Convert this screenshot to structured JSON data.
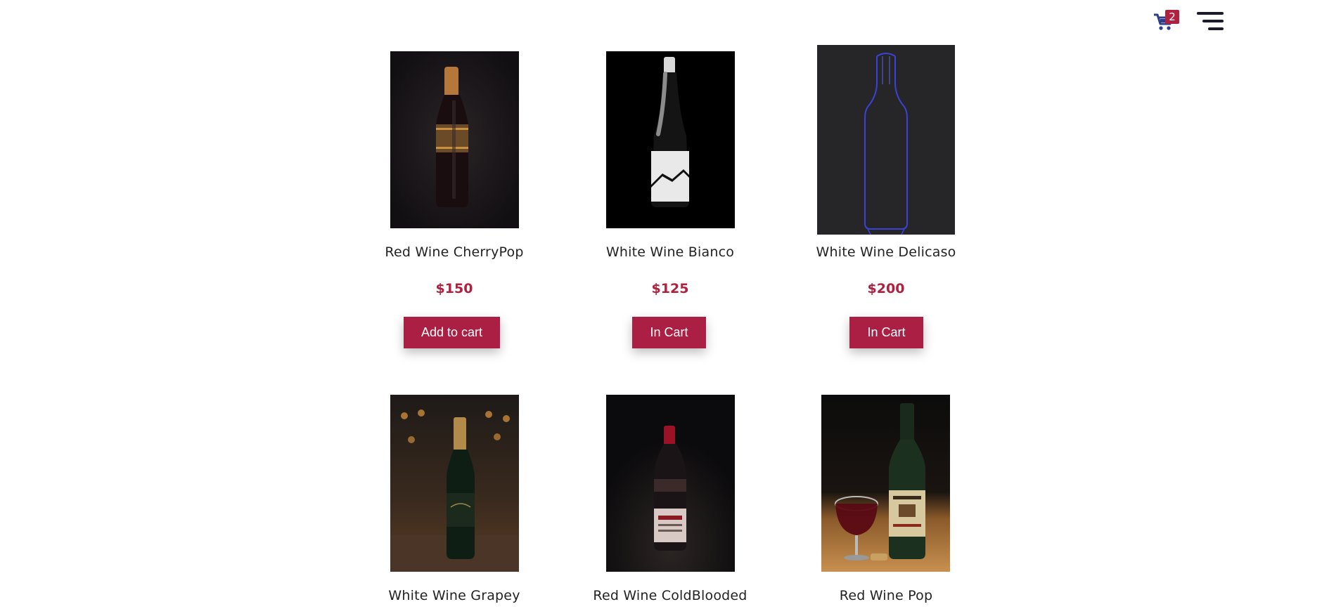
{
  "header": {
    "cart_count": "2",
    "accent_color": "#b0213f",
    "icons": [
      "cart-icon",
      "menu-icon"
    ]
  },
  "products": [
    {
      "name": "Red Wine CherryPop",
      "price": "$150",
      "button": "Add to cart",
      "image": "dark-red-wine-bottle-gold-label"
    },
    {
      "name": "White Wine Bianco",
      "price": "$125",
      "button": "In Cart",
      "image": "black-bottle-white-label"
    },
    {
      "name": "White Wine Delicaso",
      "price": "$200",
      "button": "In Cart",
      "image": "blue-outline-bottle-on-gray"
    },
    {
      "name": "White Wine Grapey",
      "price": "",
      "button": "",
      "image": "green-bottle-cellar-background"
    },
    {
      "name": "Red Wine ColdBlooded",
      "price": "",
      "button": "",
      "image": "red-capped-bottle-dark-background"
    },
    {
      "name": "Red Wine Pop",
      "price": "",
      "button": "",
      "image": "bottle-with-glass-and-cork"
    }
  ]
}
